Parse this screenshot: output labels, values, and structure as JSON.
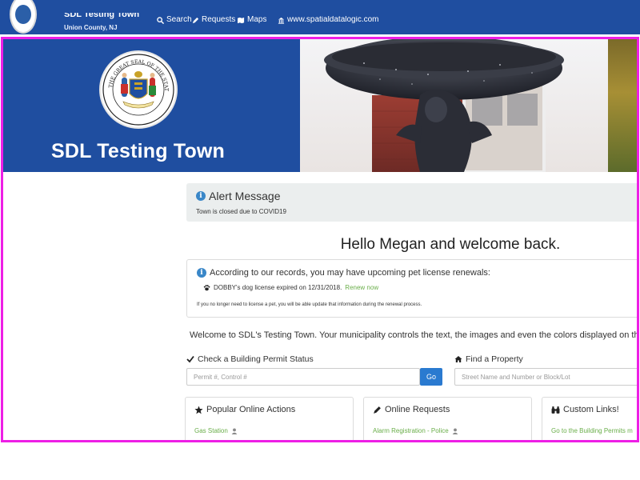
{
  "topbar": {
    "town_name": "SDL Testing Town",
    "county": "Union County, NJ",
    "nav": [
      {
        "label": "Search",
        "icon": "search-icon"
      },
      {
        "label": "Requests",
        "icon": "pencil-icon"
      },
      {
        "label": "Maps",
        "icon": "map-icon"
      },
      {
        "label": "www.spatialdatalogic.com",
        "icon": "building-icon"
      }
    ]
  },
  "hero": {
    "title": "SDL Testing Town",
    "seal_text": "THE GREAT SEAL OF THE STATE OF NEW JERSEY"
  },
  "alert": {
    "title": "Alert Message",
    "text": "Town is closed due to COVID19"
  },
  "greeting": "Hello Megan and welcome back.",
  "pet_notice": {
    "heading": "According to our records, you may have upcoming pet license renewals:",
    "item_text": "DOBBY's dog license expired on 12/31/2018.",
    "item_link": "Renew now",
    "note": "If you no longer need to license a pet, you will be able update that information during the renewal process."
  },
  "intro": "Welcome to SDL's Testing Town. Your municipality controls the text, the images and even the colors displayed on this pa",
  "permit_search": {
    "label": "Check a Building Permit Status",
    "placeholder": "Permit #, Control #",
    "button": "Go"
  },
  "property_search": {
    "label": "Find a Property",
    "placeholder": "Street Name and Number or Block/Lot"
  },
  "panels": [
    {
      "title": "Popular Online Actions",
      "icon": "star-icon",
      "link": "Gas Station"
    },
    {
      "title": "Online Requests",
      "icon": "pencil-icon",
      "link": "Alarm Registration - Police"
    },
    {
      "title": "Custom Links!",
      "icon": "binoculars-icon",
      "link": "Go to the Building Permits m"
    }
  ],
  "colors": {
    "brand_blue": "#1f4ea0",
    "frame_magenta": "#ee1ee6",
    "link_green": "#6aae4a",
    "button_blue": "#2a7ad0"
  }
}
